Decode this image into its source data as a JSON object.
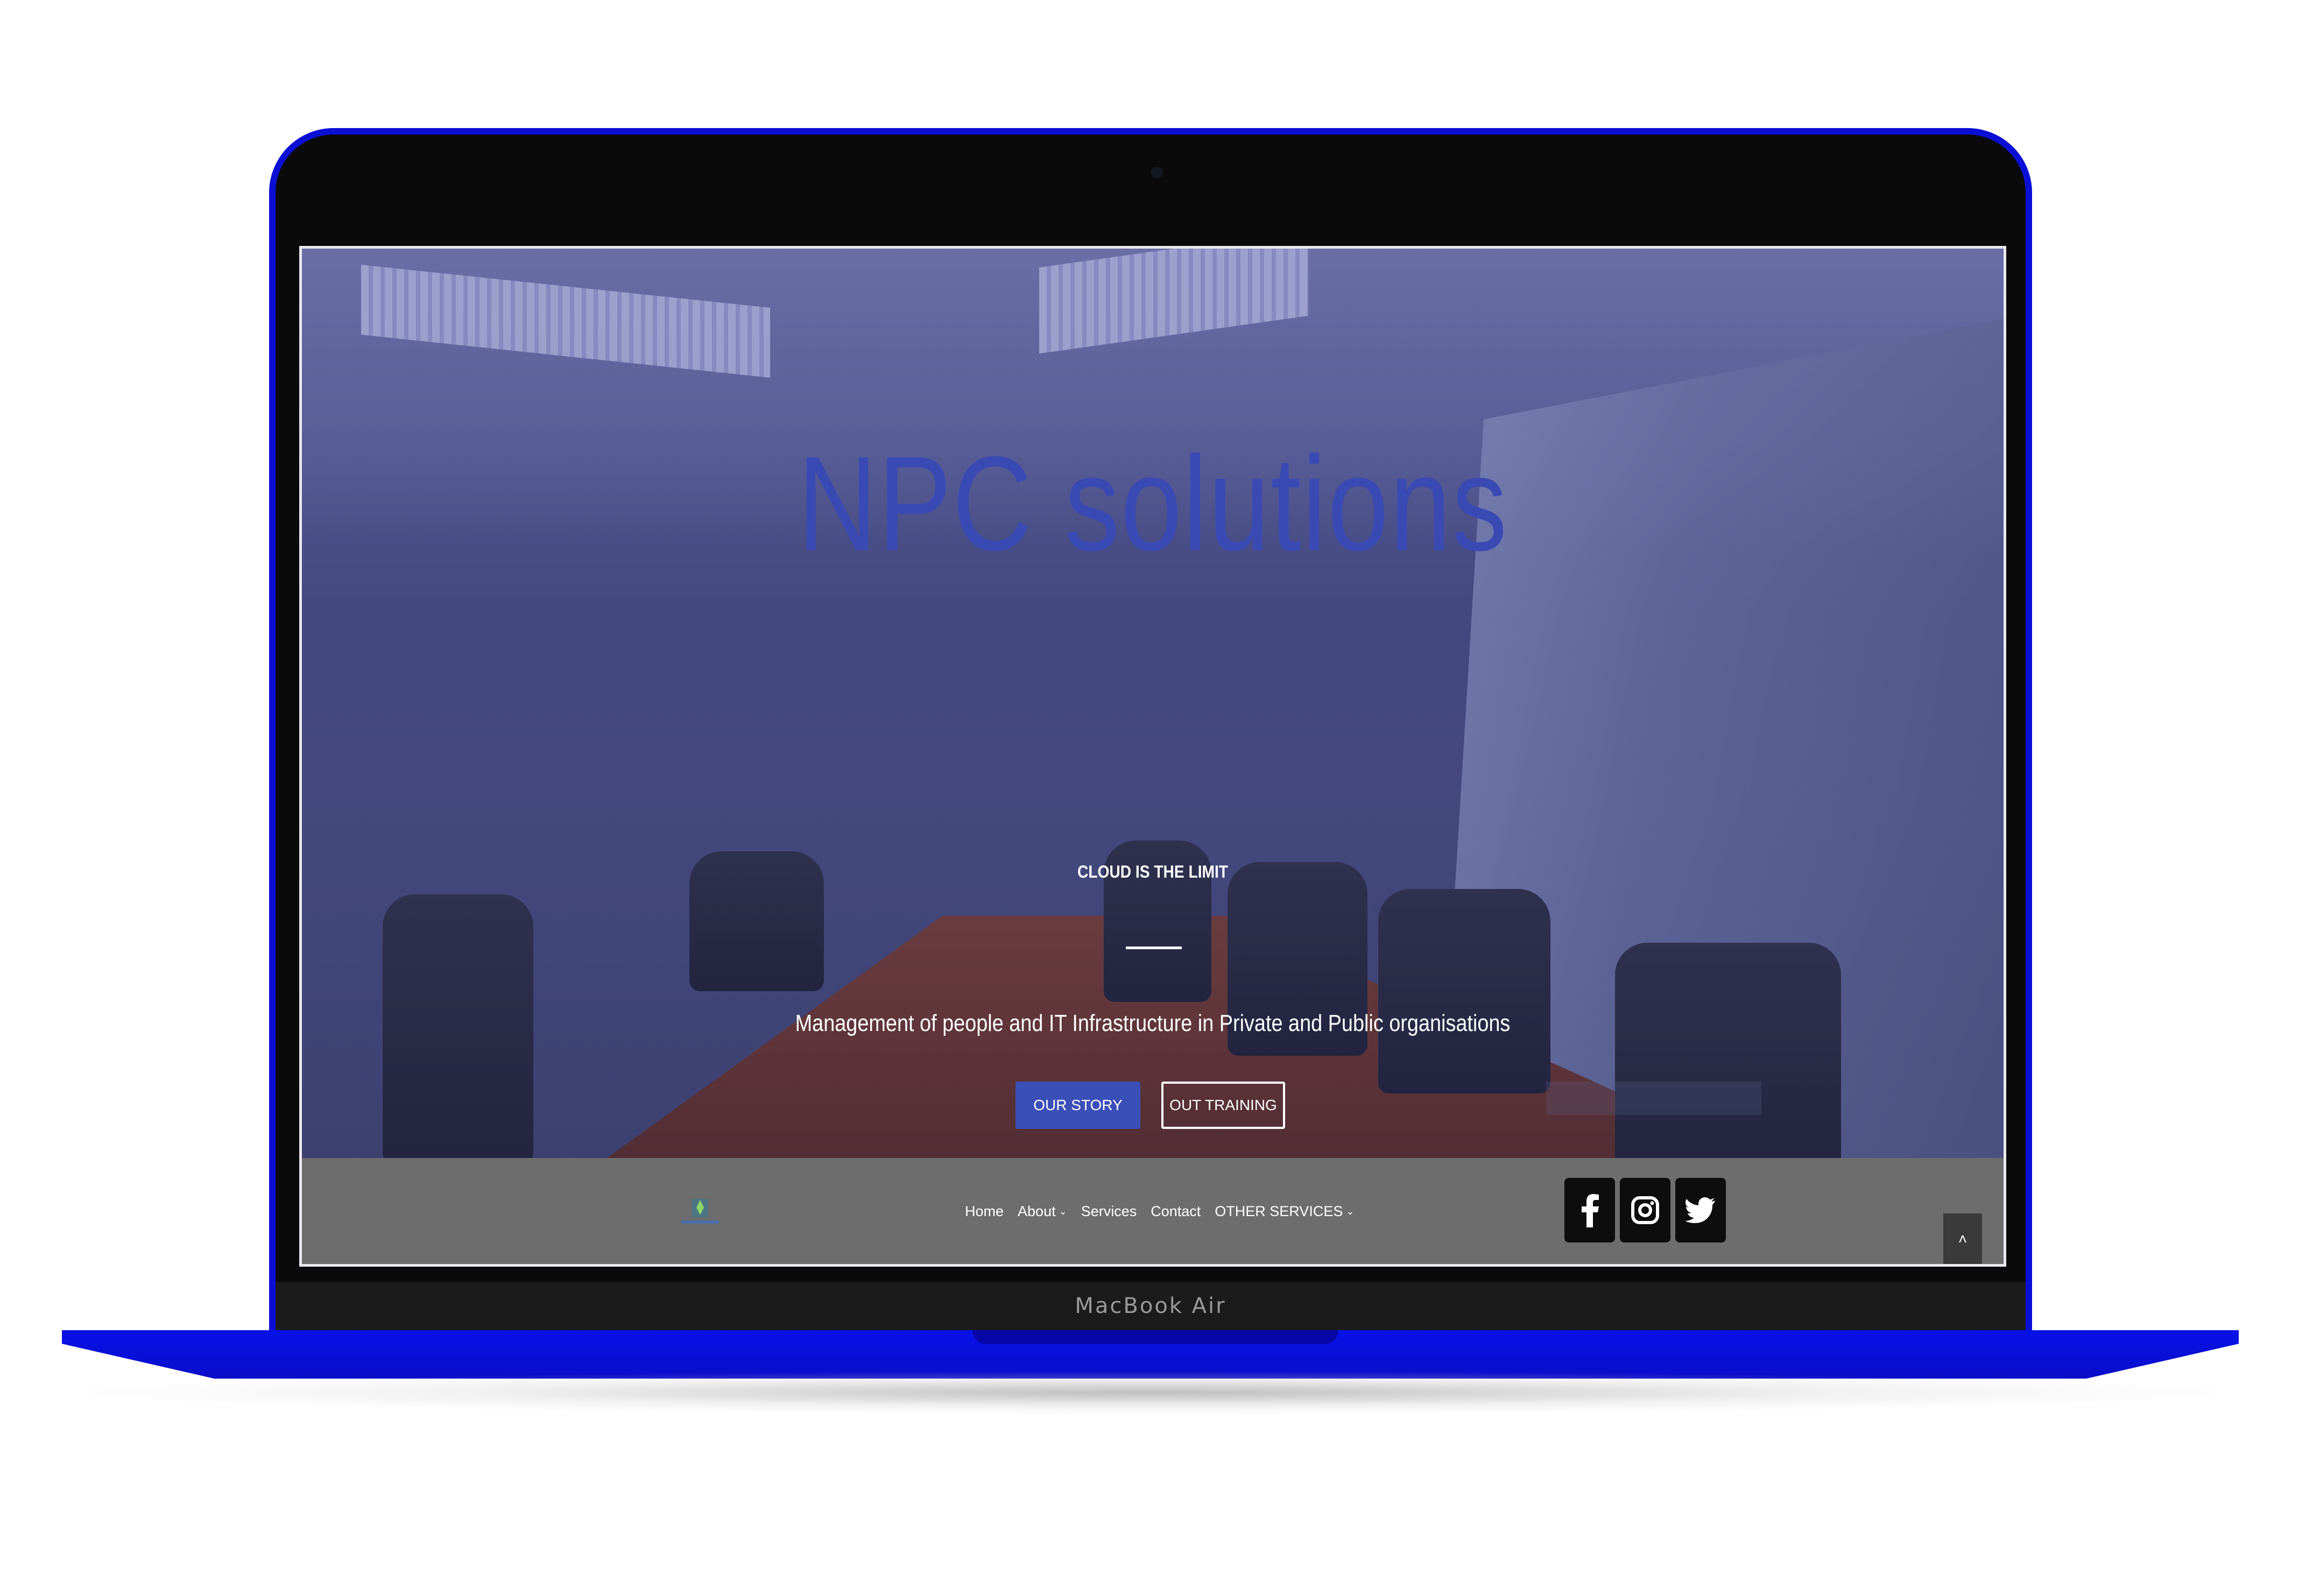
{
  "device": {
    "model_label": "MacBook Air"
  },
  "hero": {
    "title": "NPC solutions",
    "tagline": "CLOUD IS THE LIMIT",
    "subtitle": "Management of people and IT Infrastructure in Private and Public organisations",
    "primary_button": "OUR STORY",
    "secondary_button": "OUT TRAINING"
  },
  "nav": {
    "items": [
      {
        "label": "Home",
        "has_dropdown": false
      },
      {
        "label": "About",
        "has_dropdown": true
      },
      {
        "label": "Services",
        "has_dropdown": false
      },
      {
        "label": "Contact",
        "has_dropdown": false
      },
      {
        "label": "OTHER SERVICES",
        "has_dropdown": true
      }
    ],
    "dropdown_icon": "chevron-down-icon"
  },
  "social": [
    {
      "name": "facebook",
      "icon": "facebook-icon"
    },
    {
      "name": "instagram",
      "icon": "instagram-icon"
    },
    {
      "name": "twitter",
      "icon": "twitter-icon"
    }
  ],
  "scroll_top_icon": "chevron-up-icon",
  "colors": {
    "frame_accent": "#0b0fd6",
    "title_color": "#3a4ab4",
    "primary_button": "#3b4fb8",
    "footer_bar": "#6d6d6d"
  }
}
